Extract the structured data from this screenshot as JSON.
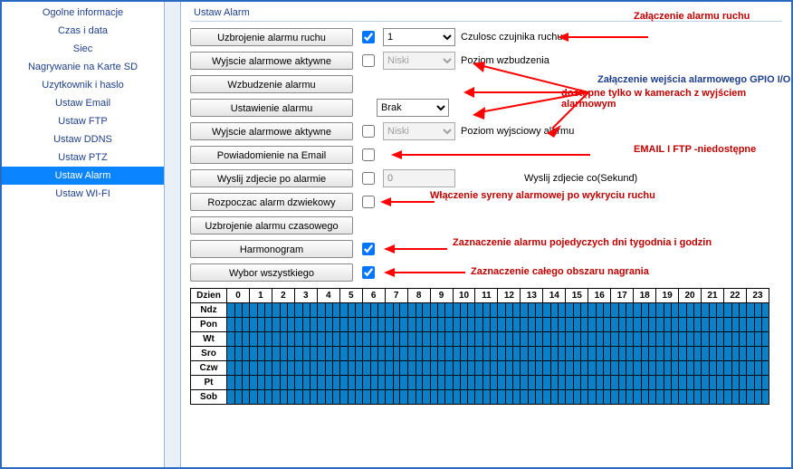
{
  "sidebar": {
    "items": [
      {
        "label": "Ogolne informacje",
        "active": false
      },
      {
        "label": "Czas i data",
        "active": false
      },
      {
        "label": "Siec",
        "active": false
      },
      {
        "label": "Nagrywanie na Karte SD",
        "active": false
      },
      {
        "label": "Uzytkownik i haslo",
        "active": false
      },
      {
        "label": "Ustaw Email",
        "active": false
      },
      {
        "label": "Ustaw FTP",
        "active": false
      },
      {
        "label": "Ustaw DDNS",
        "active": false
      },
      {
        "label": "Ustaw PTZ",
        "active": false
      },
      {
        "label": "Ustaw Alarm",
        "active": true
      },
      {
        "label": "Ustaw WI-FI",
        "active": false
      }
    ]
  },
  "panel": {
    "title": "Ustaw Alarm"
  },
  "rows": {
    "r1": {
      "btn": "Uzbrojenie alarmu ruchu",
      "checked": true,
      "select": "1",
      "label": "Czulosc czujnika ruchu"
    },
    "r2": {
      "btn": "Wyjscie alarmowe aktywne",
      "checked": false,
      "select": "Niski",
      "label": "Poziom wzbudzenia"
    },
    "r3": {
      "btn": "Wzbudzenie alarmu"
    },
    "r4": {
      "btn": "Ustawienie alarmu",
      "select": "Brak"
    },
    "r5": {
      "btn": "Wyjscie alarmowe aktywne",
      "checked": false,
      "select": "Niski",
      "label": "Poziom wyjsciowy alarmu"
    },
    "r6": {
      "btn": "Powiadomienie na Email",
      "checked": false
    },
    "r7": {
      "btn": "Wyslij zdjecie po alarmie",
      "checked": false,
      "value": "0",
      "label": "Wyslij zdjecie co(Sekund)"
    },
    "r8": {
      "btn": "Rozpoczac alarm dzwiekowy",
      "checked": false
    },
    "r9": {
      "btn": "Uzbrojenie alarmu czasowego"
    },
    "r10": {
      "btn": "Harmonogram",
      "checked": true
    },
    "r11": {
      "btn": "Wybor wszystkiego",
      "checked": true
    }
  },
  "annotations": {
    "a1": "Załączenie alarmu ruchu",
    "a2": "Załączenie wejścia alarmowego GPIO I/O",
    "a2b": "dostępne tylko w kamerach z wyjściem alarmowym",
    "a3": "EMAIL I FTP -niedostępne",
    "a4": "Włączenie syreny alarmowej po wykryciu ruchu",
    "a5": "Zaznaczenie alarmu pojedyczych dni tygodnia i godzin",
    "a6": "Zaznaczenie całego obszaru nagrania"
  },
  "schedule": {
    "corner": "Dzien",
    "hours": [
      "0",
      "1",
      "2",
      "3",
      "4",
      "5",
      "6",
      "7",
      "8",
      "9",
      "10",
      "11",
      "12",
      "13",
      "14",
      "15",
      "16",
      "17",
      "18",
      "19",
      "20",
      "21",
      "22",
      "23"
    ],
    "days": [
      "Ndz",
      "Pon",
      "Wt",
      "Sro",
      "Czw",
      "Pt",
      "Sob"
    ]
  }
}
